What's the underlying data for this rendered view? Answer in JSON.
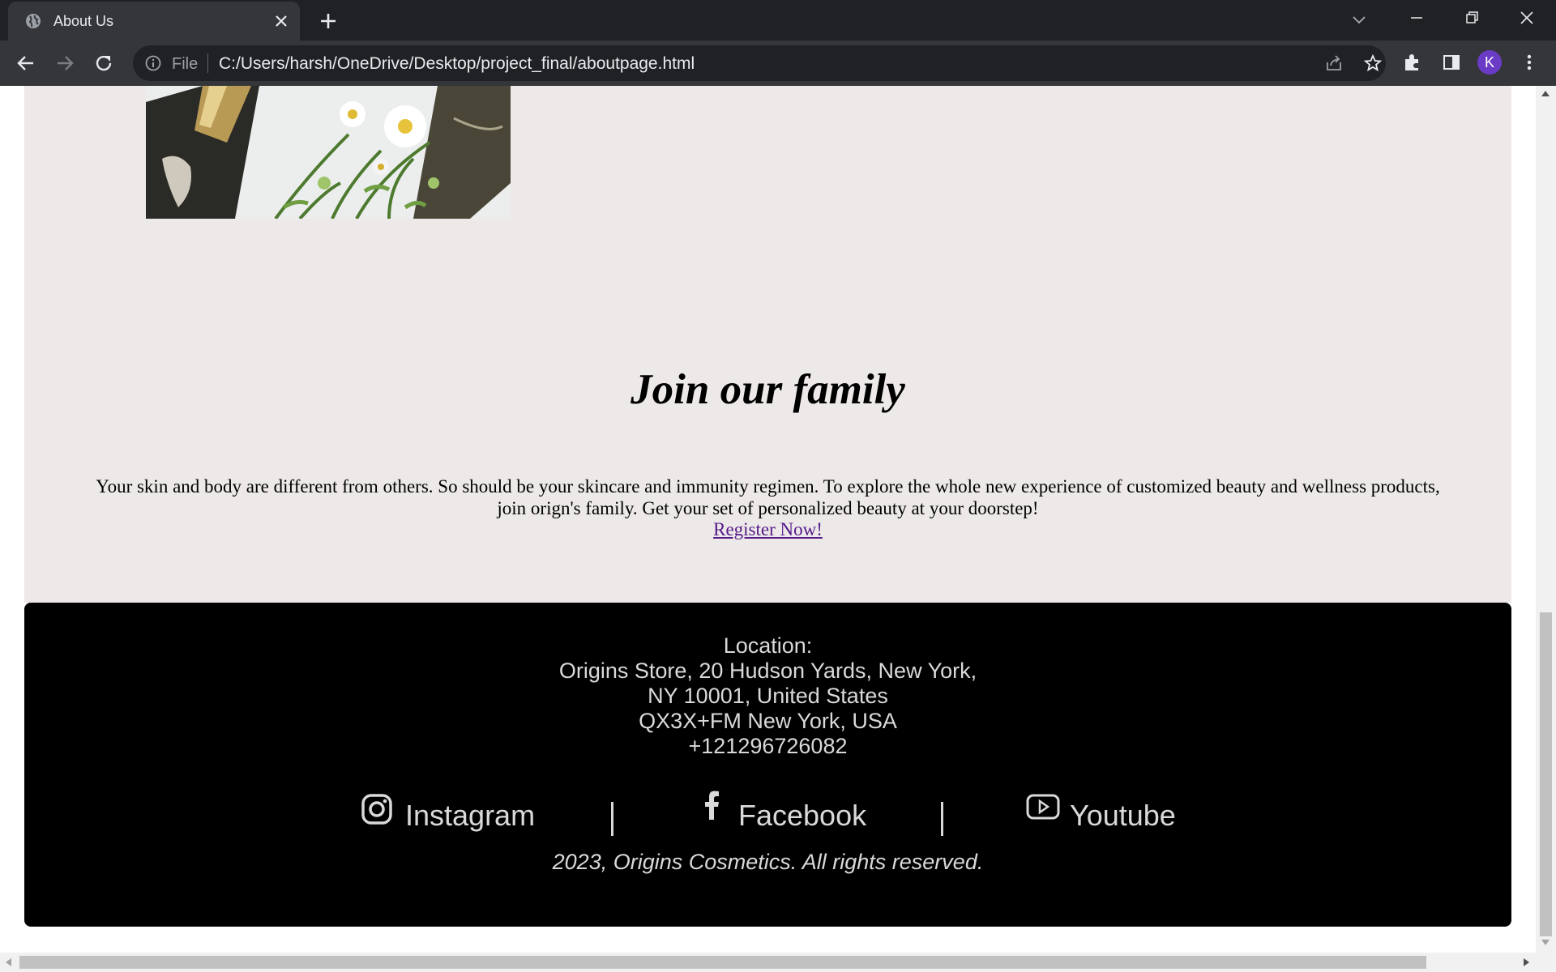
{
  "browser": {
    "tab_title": "About Us",
    "scheme_label": "File",
    "url": "C:/Users/harsh/OneDrive/Desktop/project_final/aboutpage.html",
    "profile_initial": "K",
    "accent_color": "#6a3bc5"
  },
  "join": {
    "title": "Join our family",
    "line1": "Your skin and body are different from others. So should be your skincare and immunity regimen. To explore the whole new experience of customized beauty and wellness products,",
    "line2": "join orign's family. Get your set of personalized beauty at your doorstep!",
    "register_link": "Register Now!"
  },
  "footer": {
    "location_label": "Location:",
    "address_line1": "Origins Store, 20 Hudson Yards, New York,",
    "address_line2": "NY 10001, United States",
    "plus_code": "QX3X+FM New York, USA",
    "phone": "+121296726082",
    "social": [
      {
        "label": "Instagram",
        "icon": "instagram-icon"
      },
      {
        "label": "Facebook",
        "icon": "facebook-icon"
      },
      {
        "label": "Youtube",
        "icon": "youtube-icon"
      }
    ],
    "separator": "|",
    "copyright": "2023, Origins Cosmetics. All rights reserved."
  },
  "colors": {
    "page_background": "#ede9e8",
    "footer_background": "#000000",
    "footer_text": "#d9d9d9",
    "link_visited": "#551a8b"
  }
}
